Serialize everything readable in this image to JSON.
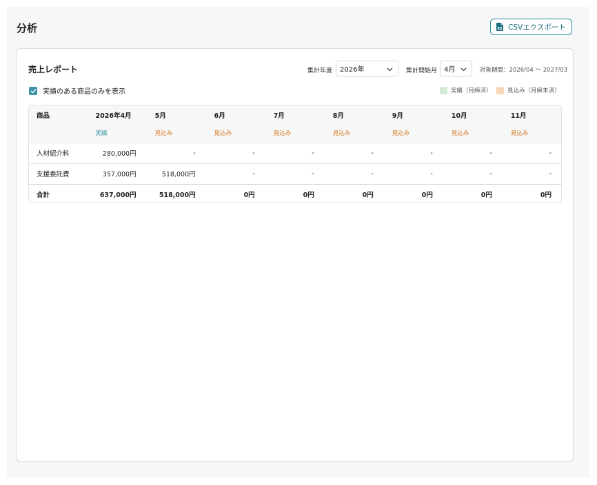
{
  "page": {
    "title": "分析",
    "csv_button_label": "CSVエクスポート",
    "csv_icon": "file-spreadsheet-icon"
  },
  "report": {
    "title": "売上レポート",
    "fiscal_year_label": "集計年度",
    "fiscal_year_value": "2026年",
    "start_month_label": "集計開始月",
    "start_month_value": "4月",
    "period_text": "対象期間：2026/04 ～ 2027/03",
    "filter_label": "実績のある商品のみを表示",
    "filter_checked": true,
    "legend": {
      "actual": "実績（月締済）",
      "forecast": "見込み（月締未済）",
      "actual_color": "#d6ead8",
      "forecast_color": "#f7d8b8"
    }
  },
  "table": {
    "header_product": "商品",
    "months": [
      "2026年4月",
      "5月",
      "6月",
      "7月",
      "8月",
      "9月",
      "10月",
      "11月"
    ],
    "status": [
      "実績",
      "見込み",
      "見込み",
      "見込み",
      "見込み",
      "見込み",
      "見込み",
      "見込み"
    ],
    "rows": [
      {
        "name": "人材紹介料",
        "values": [
          "280,000円",
          "-",
          "-",
          "-",
          "-",
          "-",
          "-",
          "-"
        ]
      },
      {
        "name": "支援委託費",
        "values": [
          "357,000円",
          "518,000円",
          "-",
          "-",
          "-",
          "-",
          "-",
          "-"
        ]
      }
    ],
    "total": {
      "name": "合計",
      "values": [
        "637,000円",
        "518,000円",
        "0円",
        "0円",
        "0円",
        "0円",
        "0円",
        "0円"
      ]
    }
  },
  "colors": {
    "accent": "#2e8a9c",
    "actual_text": "#3a93a8",
    "forecast_text": "#d9741a"
  }
}
